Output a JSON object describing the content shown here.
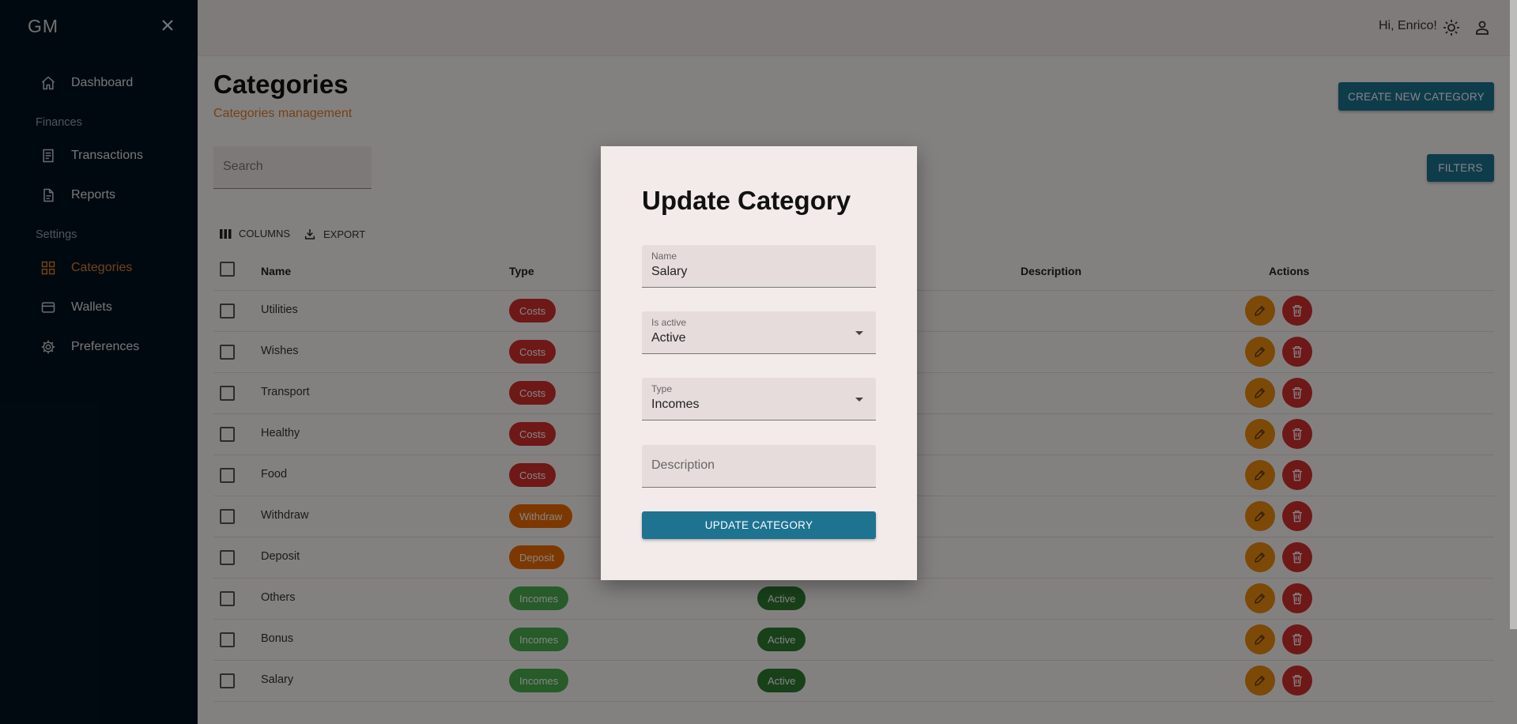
{
  "sidebar": {
    "logo": "GM",
    "items": [
      {
        "label": "Dashboard",
        "icon": "home-icon"
      },
      {
        "label": "Transactions",
        "icon": "receipt-icon"
      },
      {
        "label": "Reports",
        "icon": "document-icon"
      },
      {
        "label": "Categories",
        "icon": "category-grid-icon",
        "active": true
      },
      {
        "label": "Wallets",
        "icon": "wallet-icon"
      },
      {
        "label": "Preferences",
        "icon": "gear-icon"
      }
    ],
    "sections": {
      "finances": "Finances",
      "settings": "Settings"
    }
  },
  "header": {
    "greeting": "Hi, Enrico!",
    "theme_icon": "sun-icon",
    "user_icon": "user-icon"
  },
  "page": {
    "title": "Categories",
    "subtitle": "Categories management",
    "create_button": "CREATE NEW CATEGORY",
    "filters_button": "FILTERS",
    "search_placeholder": "Search",
    "toolbar": {
      "columns": "COLUMNS",
      "export": "EXPORT"
    }
  },
  "table": {
    "headers": {
      "name": "Name",
      "type": "Type",
      "description": "Description",
      "actions": "Actions"
    },
    "rows": [
      {
        "name": "Utilities",
        "type": "Costs",
        "status": ""
      },
      {
        "name": "Wishes",
        "type": "Costs",
        "status": ""
      },
      {
        "name": "Transport",
        "type": "Costs",
        "status": ""
      },
      {
        "name": "Healthy",
        "type": "Costs",
        "status": ""
      },
      {
        "name": "Food",
        "type": "Costs",
        "status": ""
      },
      {
        "name": "Withdraw",
        "type": "Withdraw",
        "status": ""
      },
      {
        "name": "Deposit",
        "type": "Deposit",
        "status": ""
      },
      {
        "name": "Others",
        "type": "Incomes",
        "status": "Active"
      },
      {
        "name": "Bonus",
        "type": "Incomes",
        "status": "Active"
      },
      {
        "name": "Salary",
        "type": "Incomes",
        "status": "Active"
      }
    ]
  },
  "modal": {
    "title": "Update Category",
    "name": {
      "label": "Name",
      "value": "Salary"
    },
    "is_active": {
      "label": "Is active",
      "value": "Active"
    },
    "type": {
      "label": "Type",
      "value": "Incomes"
    },
    "description": {
      "placeholder": "Description"
    },
    "submit": "UPDATE CATEGORY"
  },
  "colors": {
    "sidebar_bg": "#01131f",
    "accent_orange": "#e07e2c",
    "primary_button": "#1e7390",
    "costs_chip": "#d32f2f",
    "withdraw_chip": "#ef6c00",
    "incomes_chip": "#4caf50",
    "active_chip": "#2e7d32"
  }
}
